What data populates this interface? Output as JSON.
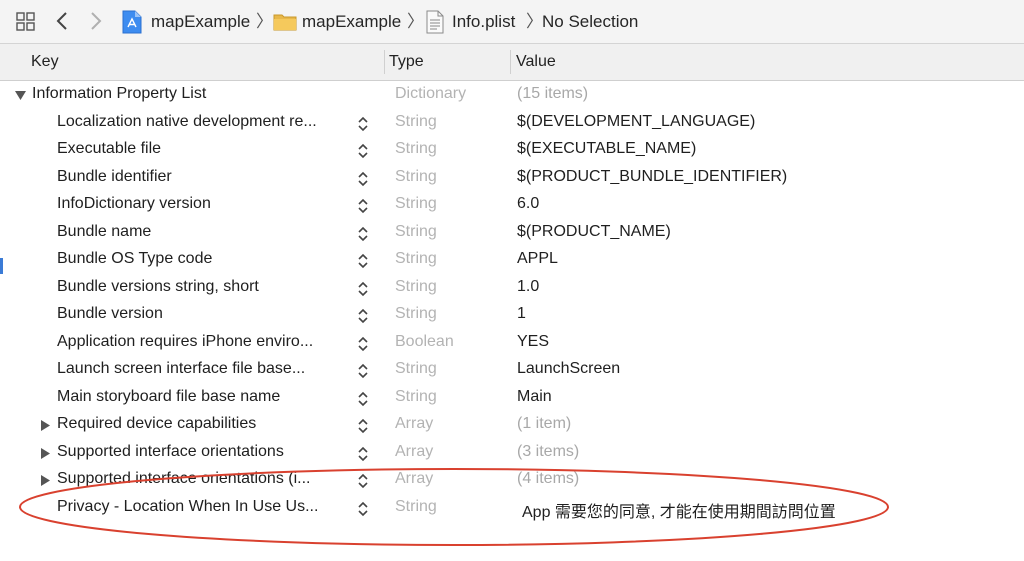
{
  "jumpbar": {
    "crumbs": [
      "mapExample",
      "mapExample",
      "Info.plist",
      "No Selection"
    ]
  },
  "header": {
    "key": "Key",
    "type": "Type",
    "value": "Value"
  },
  "root": {
    "key": "Information Property List",
    "type": "Dictionary",
    "value": "(15 items)"
  },
  "rows": [
    {
      "key": "Localization native development re...",
      "type": "String",
      "value": "$(DEVELOPMENT_LANGUAGE)"
    },
    {
      "key": "Executable file",
      "type": "String",
      "value": "$(EXECUTABLE_NAME)"
    },
    {
      "key": "Bundle identifier",
      "type": "String",
      "value": "$(PRODUCT_BUNDLE_IDENTIFIER)"
    },
    {
      "key": "InfoDictionary version",
      "type": "String",
      "value": "6.0"
    },
    {
      "key": "Bundle name",
      "type": "String",
      "value": "$(PRODUCT_NAME)"
    },
    {
      "key": "Bundle OS Type code",
      "type": "String",
      "value": "APPL"
    },
    {
      "key": "Bundle versions string, short",
      "type": "String",
      "value": "1.0"
    },
    {
      "key": "Bundle version",
      "type": "String",
      "value": "1"
    },
    {
      "key": "Application requires iPhone enviro...",
      "type": "Boolean",
      "value": "YES"
    },
    {
      "key": "Launch screen interface file base...",
      "type": "String",
      "value": "LaunchScreen"
    },
    {
      "key": "Main storyboard file base name",
      "type": "String",
      "value": "Main"
    },
    {
      "key": "Required device capabilities",
      "type": "Array",
      "value": "(1 item)"
    },
    {
      "key": "Supported interface orientations",
      "type": "Array",
      "value": "(3 items)"
    },
    {
      "key": "Supported interface orientations (i...",
      "type": "Array",
      "value": "(4 items)"
    },
    {
      "key": "Privacy - Location When In Use Us...",
      "type": "String",
      "value": "App 需要您的同意, 才能在使用期間訪問位置"
    }
  ],
  "colors": {
    "annotation": "#d9412f",
    "type_text": "#b3b3b3",
    "accent": "#3b7bd6"
  }
}
